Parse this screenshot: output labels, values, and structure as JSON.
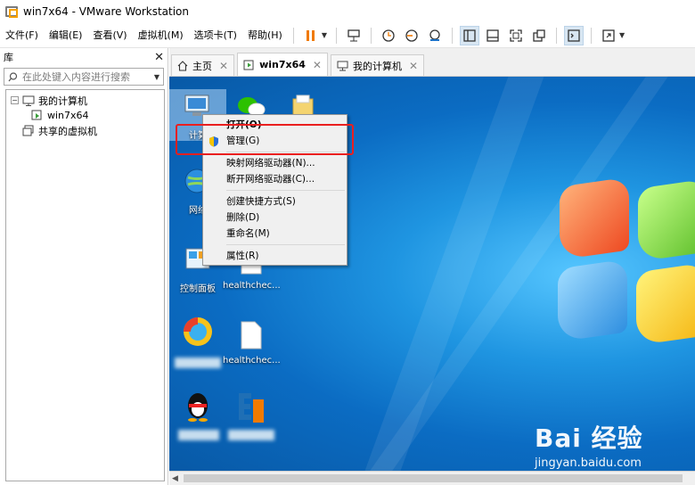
{
  "window": {
    "title": "win7x64 - VMware Workstation"
  },
  "menu": [
    "文件(F)",
    "编辑(E)",
    "查看(V)",
    "虚拟机(M)",
    "选项卡(T)",
    "帮助(H)"
  ],
  "library": {
    "title": "库",
    "search_placeholder": "在此处键入内容进行搜索",
    "tree": [
      {
        "label": "我的计算机",
        "level": 0,
        "expanded": true,
        "icon": "computer-icon"
      },
      {
        "label": "win7x64",
        "level": 1,
        "icon": "vm-icon"
      },
      {
        "label": "共享的虚拟机",
        "level": 0,
        "icon": "shared-vm-icon"
      }
    ]
  },
  "tabs": [
    {
      "label": "主页",
      "icon": "home-icon",
      "active": false
    },
    {
      "label": "win7x64",
      "icon": "vm-icon",
      "active": true
    },
    {
      "label": "我的计算机",
      "icon": "computer-icon",
      "active": false
    }
  ],
  "desktop": {
    "icons": [
      {
        "label": "计算",
        "icon": "computer-icon"
      },
      {
        "label": "网络",
        "icon": "network-icon"
      },
      {
        "label": "控制面板",
        "icon": "control-panel-icon"
      },
      {
        "label": "healthchec...",
        "icon": "file-icon"
      },
      {
        "label": "healthchec...",
        "icon": "file-icon"
      }
    ]
  },
  "context_menu": {
    "items": [
      {
        "label": "打开(O)",
        "bold": true
      },
      {
        "label": "管理(G)",
        "icon": "shield-icon"
      },
      {
        "sep": true
      },
      {
        "label": "映射网络驱动器(N)..."
      },
      {
        "label": "断开网络驱动器(C)..."
      },
      {
        "sep": true
      },
      {
        "label": "创建快捷方式(S)"
      },
      {
        "label": "删除(D)"
      },
      {
        "label": "重命名(M)"
      },
      {
        "sep": true
      },
      {
        "label": "属性(R)"
      }
    ]
  },
  "watermark": {
    "logo": "Bai 经验",
    "url": "jingyan.baidu.com"
  },
  "colors": {
    "highlight": "#ea1f1f",
    "pause": "#f07a00",
    "desktop": "#1f95e1"
  }
}
